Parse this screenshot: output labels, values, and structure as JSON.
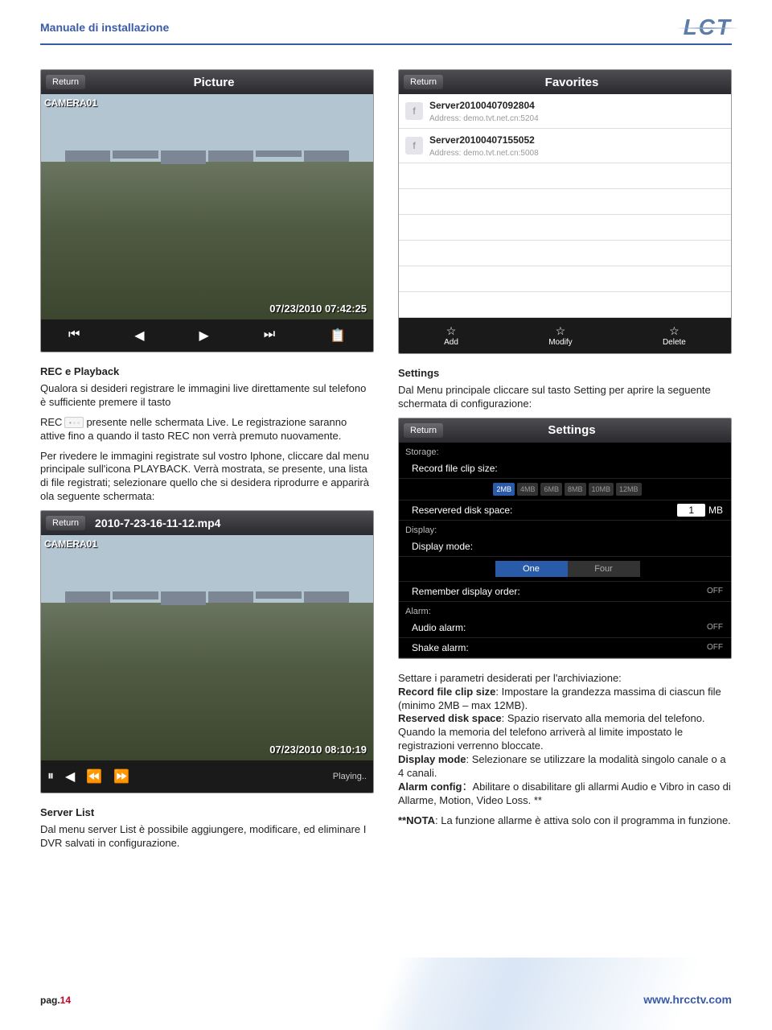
{
  "header": {
    "title": "Manuale di installazione",
    "logo": "LCT"
  },
  "left": {
    "picture_shot": {
      "return": "Return",
      "title": "Picture",
      "cam_label": "CAMERA01",
      "timestamp": "07/23/2010  07:42:25",
      "controls": [
        "⏮",
        "◀",
        "▶",
        "⏭",
        "📋"
      ]
    },
    "h_rec": "REC e Playback",
    "p1a": "Qualora si desideri registrare le immagini live direttamente sul telefono è sufficiente premere il tasto",
    "p1b_prefix": "REC",
    "p1b_rest": "presente nelle schermata Live. Le registrazione saranno attive fino a quando il tasto REC non verrà premuto nuovamente.",
    "p1c": "Per rivedere le immagini registrate sul vostro Iphone, cliccare dal menu principale sull'icona PLAYBACK. Verrà mostrata, se presente, una lista di file registrati; selezionare quello che si desidera riprodurre e apparirà ola seguente schermata:",
    "playback_shot": {
      "return": "Return",
      "title": "2010-7-23-16-11-12.mp4",
      "cam_label": "CAMERA01",
      "timestamp": "07/23/2010  08:10:19",
      "controls": [
        "⏸",
        "◀",
        "⏪",
        "⏩"
      ],
      "status": "Playing.."
    },
    "h_server": "Server List",
    "p_server": "Dal menu server List è possibile aggiungere, modificare, ed eliminare I DVR salvati in configurazione."
  },
  "right": {
    "fav_shot": {
      "return": "Return",
      "title": "Favorites",
      "rows": [
        {
          "name": "Server20100407092804",
          "addr": "Address: demo.tvt.net.cn:5204"
        },
        {
          "name": "Server20100407155052",
          "addr": "Address: demo.tvt.net.cn:5008"
        }
      ],
      "bottom": [
        {
          "icon": "☆",
          "label": "Add"
        },
        {
          "icon": "☆",
          "label": "Modify"
        },
        {
          "icon": "☆",
          "label": "Delete"
        }
      ]
    },
    "h_settings": "Settings",
    "p_settings_intro": "Dal Menu principale cliccare sul tasto Setting per aprire la seguente schermata di configurazione:",
    "settings_shot": {
      "return": "Return",
      "title": "Settings",
      "storage": "Storage:",
      "row_clip": "Record file clip size:",
      "clip_opts": [
        "2MB",
        "4MB",
        "6MB",
        "8MB",
        "10MB",
        "12MB"
      ],
      "clip_active": 0,
      "row_disk": "Reservered disk space:",
      "disk_val": "1",
      "disk_unit": "MB",
      "display": "Display:",
      "row_mode": "Display mode:",
      "mode_opts": [
        "One",
        "Four"
      ],
      "mode_active": 0,
      "row_remember": "Remember display order:",
      "remember_val": "OFF",
      "alarm": "Alarm:",
      "row_audio": "Audio alarm:",
      "audio_val": "OFF",
      "row_shake": "Shake alarm:",
      "shake_val": "OFF"
    },
    "params_intro": "Settare i parametri desiderati per l'archiviazione:",
    "b1": "Record file clip size",
    "b1_txt": ": Impostare la grandezza massima di ciascun file (minimo 2MB – max 12MB).",
    "b2": "Reserved disk space",
    "b2_txt": ": Spazio riservato alla memoria del telefono. Quando la memoria del telefono arriverà al limite impostato le registrazioni verrenno bloccate.",
    "b3": "Display mode",
    "b3_txt": ": Selezionare se utilizzare la modalità singolo canale o a 4 canali.",
    "b4": "Alarm config",
    "b4_txt": "：Abilitare o disabilitare gli allarmi Audio e Vibro in caso di Allarme, Motion, Video Loss. **",
    "nota_b": "**NOTA",
    "nota_txt": ": La funzione allarme è attiva solo con il programma in funzione."
  },
  "footer": {
    "page_label": "pag.",
    "page_num": "14",
    "url": "www.hrcctv.com"
  }
}
